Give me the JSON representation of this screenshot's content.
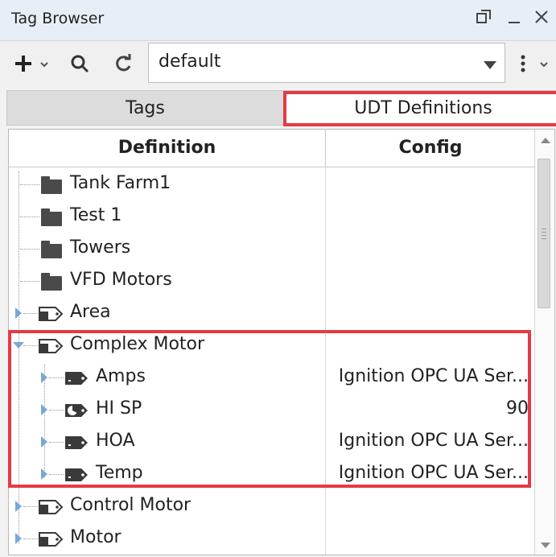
{
  "window": {
    "title": "Tag Browser"
  },
  "toolbar": {
    "add_icon": "plus-icon",
    "search_icon": "search-icon",
    "refresh_icon": "refresh-icon",
    "provider_value": "default",
    "more_icon": "kebab-menu-icon"
  },
  "tabs": [
    {
      "label": "Tags"
    },
    {
      "label": "UDT Definitions"
    }
  ],
  "tree": {
    "columns": {
      "definition": "Definition",
      "config": "Config"
    },
    "rows": [
      {
        "label": "Tank Farm1",
        "config": ""
      },
      {
        "label": "Test 1",
        "config": ""
      },
      {
        "label": "Towers",
        "config": ""
      },
      {
        "label": "VFD Motors",
        "config": ""
      },
      {
        "label": "Area",
        "config": ""
      },
      {
        "label": "Complex Motor",
        "config": ""
      },
      {
        "label": "Amps",
        "config": "Ignition OPC UA Ser..."
      },
      {
        "label": "HI SP",
        "config": "90"
      },
      {
        "label": "HOA",
        "config": "Ignition OPC UA Ser..."
      },
      {
        "label": "Temp",
        "config": "Ignition OPC UA Ser..."
      },
      {
        "label": "Control Motor",
        "config": ""
      },
      {
        "label": "Motor",
        "config": ""
      }
    ]
  },
  "colors": {
    "highlight": "#e63946",
    "expander": "#7aa7d6",
    "titlebar": "#e8eef6"
  }
}
